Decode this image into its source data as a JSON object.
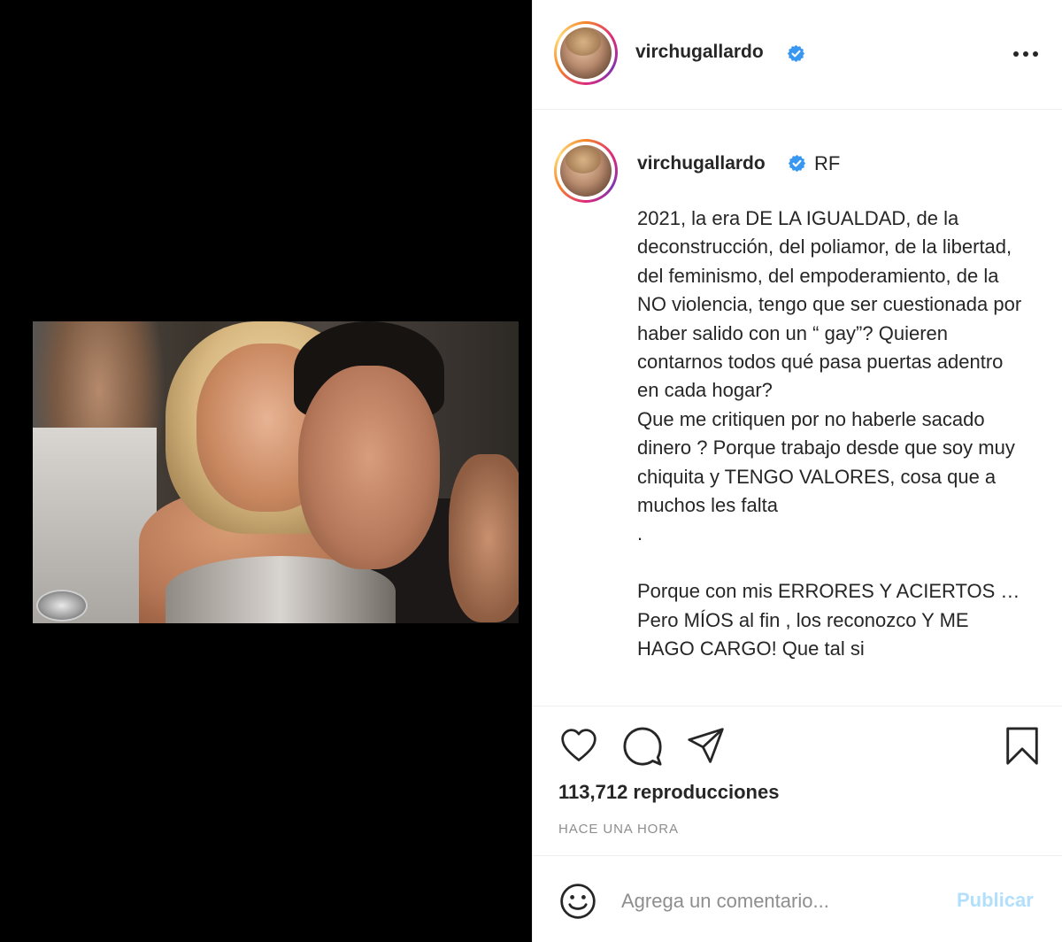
{
  "header": {
    "username": "virchugallardo"
  },
  "caption": {
    "username": "virchugallardo",
    "tag": "RF",
    "text": "2021, la era DE LA IGUALDAD, de la deconstrucción, del poliamor, de la libertad, del feminismo, del empoderamiento, de la NO violencia, tengo que ser cuestionada por haber salido con un “ gay”? Quieren contarnos todos qué pasa puertas adentro en cada hogar?\nQue me critiquen por no haberle sacado dinero ? Porque trabajo desde que soy muy chiquita y TENGO VALORES, cosa que a muchos les falta\n.\n\nPorque con mis ERRORES Y ACIERTOS … Pero MÍOS al fin , los reconozco Y ME HAGO CARGO! Que tal si"
  },
  "stats": {
    "views": "113,712 reproducciones",
    "time": "HACE UNA HORA"
  },
  "comment": {
    "placeholder": "Agrega un comentario...",
    "publish_label": "Publicar"
  },
  "icons": {
    "verified": "verified-badge-icon",
    "more": "more-options-icon",
    "like": "heart-icon",
    "comment": "comment-icon",
    "share": "paper-plane-icon",
    "save": "bookmark-icon",
    "emoji": "emoji-icon"
  },
  "colors": {
    "verified_blue": "#3897f0",
    "publish_disabled": "#b2dffc",
    "secondary_text": "#8e8e8e"
  }
}
